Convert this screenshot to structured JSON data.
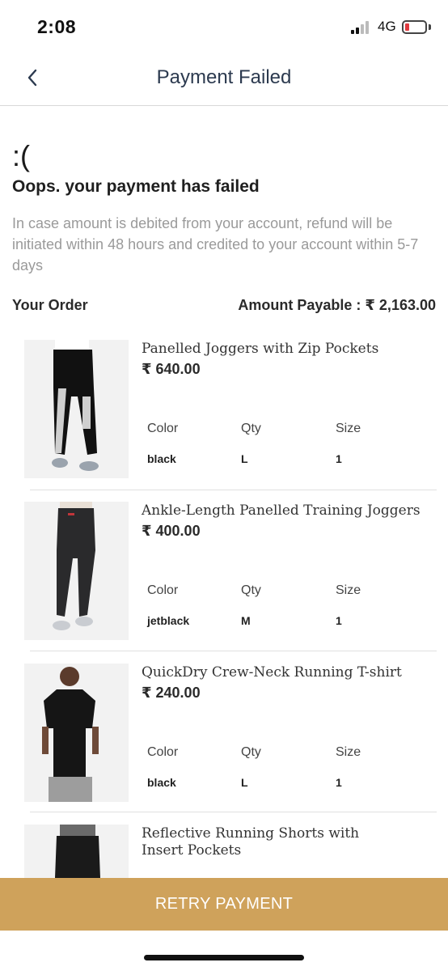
{
  "status_bar": {
    "time": "2:08",
    "network": "4G",
    "signal_icon": "signal-bars-icon",
    "battery_icon": "battery-low-icon",
    "battery_color": "#e0393e"
  },
  "header": {
    "title": "Payment Failed",
    "back_icon": "chevron-left-icon"
  },
  "message": {
    "face": ":(",
    "title": "Oops. your payment has failed",
    "description": "In case amount is debited from your account, refund will be initiated within 48 hours and credited to your account within 5-7 days"
  },
  "order": {
    "label": "Your Order",
    "amount_label": "Amount Payable : ₹ 2,163.00"
  },
  "attr_labels": {
    "color": "Color",
    "qty": "Qty",
    "size": "Size"
  },
  "items": [
    {
      "name": "Panelled Joggers with Zip Pockets",
      "price": "₹ 640.00",
      "color": "black",
      "qty": "L",
      "size": "1"
    },
    {
      "name": "Ankle-Length Panelled Training Joggers",
      "price": "₹ 400.00",
      "color": "jetblack",
      "qty": "M",
      "size": "1"
    },
    {
      "name": "QuickDry Crew-Neck Running T-shirt",
      "price": "₹ 240.00",
      "color": "black",
      "qty": "L",
      "size": "1"
    },
    {
      "name": "Reflective Running Shorts with Insert Pockets",
      "price": ""
    }
  ],
  "retry": {
    "label": "RETRY PAYMENT",
    "color": "#cfa25b"
  }
}
